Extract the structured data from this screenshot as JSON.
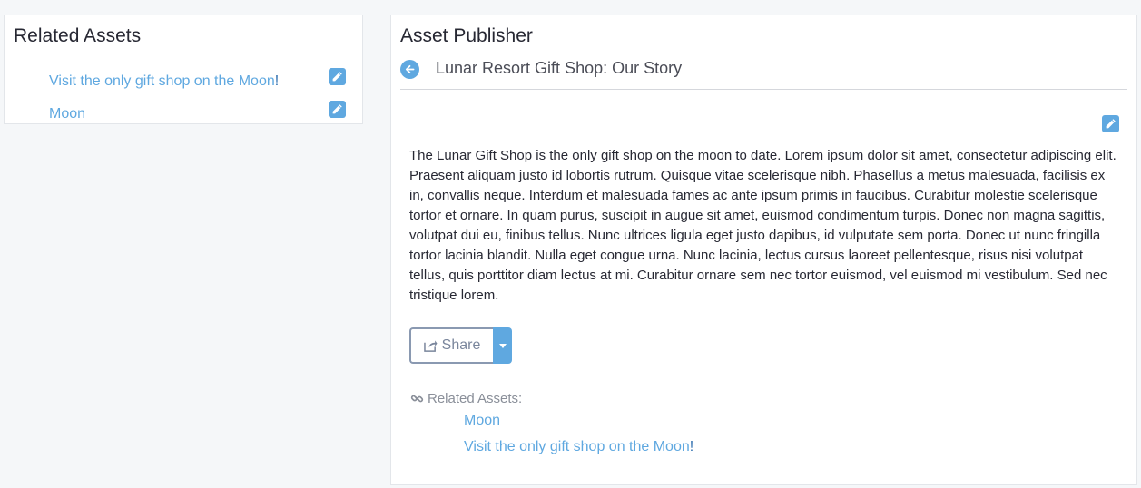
{
  "related_assets_panel": {
    "title": "Related Assets",
    "links": [
      {
        "label": "Visit the only gift shop on the Moon",
        "suffix": "!"
      },
      {
        "label": "Moon",
        "suffix": ""
      }
    ]
  },
  "asset_publisher": {
    "title": "Asset Publisher",
    "asset_title": "Lunar Resort Gift Shop: Our Story",
    "body": "The Lunar Gift Shop is the only gift shop on the moon to date. Lorem ipsum dolor sit amet, consectetur adipiscing elit. Praesent aliquam justo id lobortis rutrum. Quisque vitae scelerisque nibh. Phasellus a metus malesuada, facilisis ex in, convallis neque. Interdum et malesuada fames ac ante ipsum primis in faucibus. Curabitur molestie scelerisque tortor et ornare. In quam purus, suscipit in augue sit amet, euismod condimentum turpis. Donec non magna sagittis, volutpat dui eu, finibus tellus. Nunc ultrices ligula eget justo dapibus, id vulputate sem porta. Donec ut nunc fringilla tortor lacinia blandit. Nulla eget congue urna. Nunc lacinia, lectus cursus laoreet pellentesque, risus nisi volutpat tellus, quis porttitor diam lectus at mi. Curabitur ornare sem nec tortor euismod, vel euismod mi vestibulum. Sed nec tristique lorem.",
    "share_label": "Share",
    "related_label": "Related Assets:",
    "related_links": [
      {
        "label": "Moon",
        "suffix": ""
      },
      {
        "label": "Visit the only gift shop on the Moon",
        "suffix": "!"
      }
    ]
  },
  "colors": {
    "accent": "#5fa8e0",
    "background": "#f5f7f9",
    "panel": "#ffffff"
  },
  "icons": {
    "edit": "pencil-icon",
    "back": "arrow-left-icon",
    "share": "share-icon",
    "caret": "caret-down-icon",
    "link": "link-icon"
  }
}
